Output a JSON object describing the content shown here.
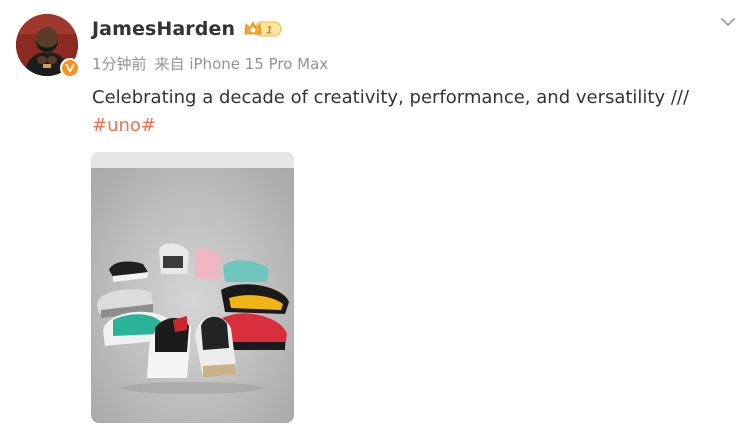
{
  "author": {
    "name": "JamesHarden",
    "vip_level": "1",
    "avatar_icon": "avatar-photo",
    "verified_icon": "verified-v-badge"
  },
  "meta": {
    "time": "1分钟前",
    "source_prefix": "来自",
    "device": "iPhone 15 Pro Max"
  },
  "post": {
    "text": "Celebrating a decade of creativity, performance, and versatility ///",
    "hashtag": "#uno#"
  },
  "image": {
    "icon": "sneakers-photo"
  },
  "colors": {
    "hashtag": "#eb7350",
    "meta": "#939393",
    "verified": "#f7931e"
  }
}
